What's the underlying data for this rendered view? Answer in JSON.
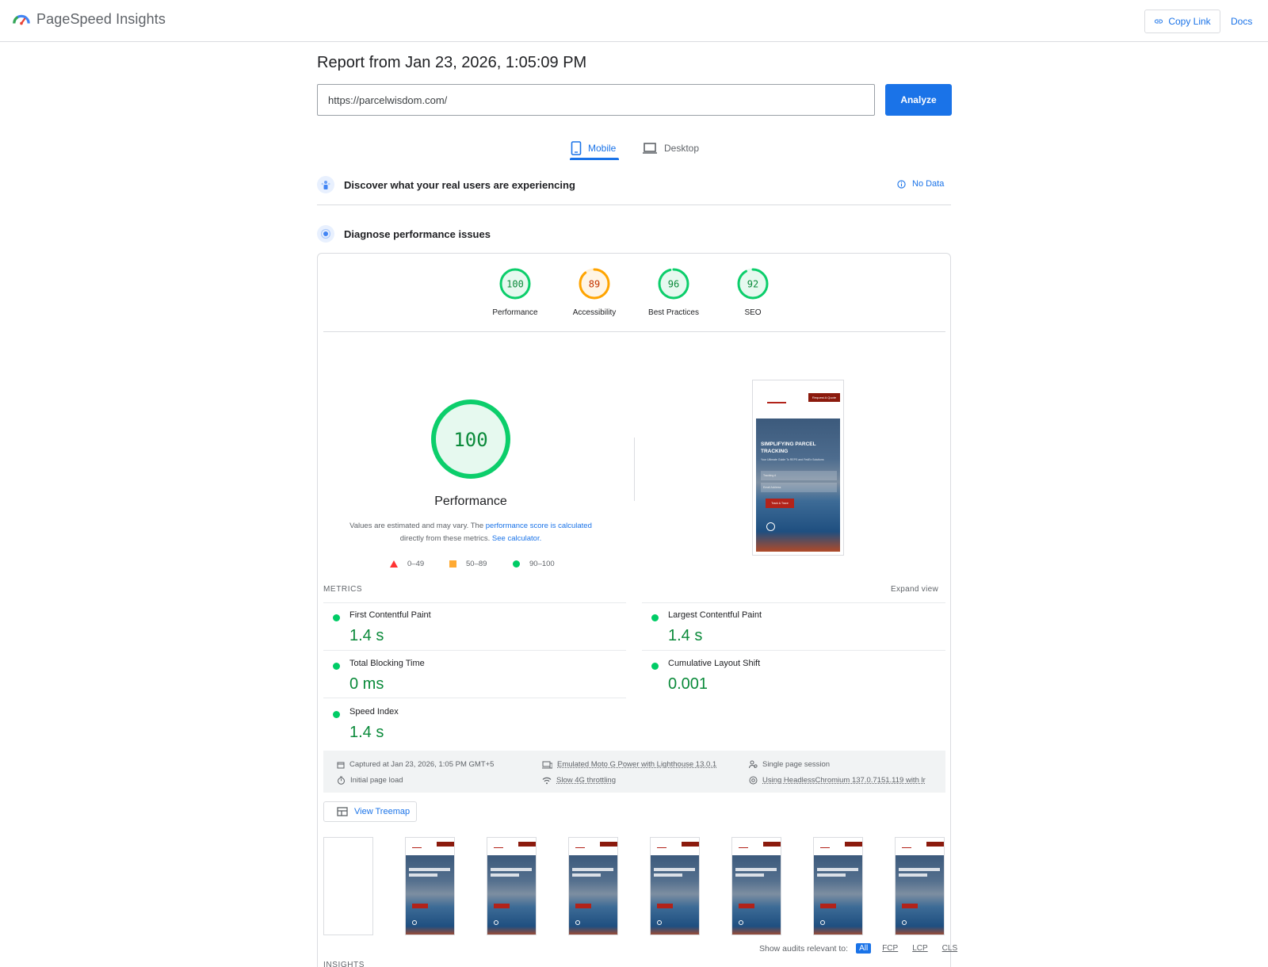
{
  "header": {
    "brand": "PageSpeed Insights",
    "copy_link": "Copy Link",
    "docs": "Docs"
  },
  "report": {
    "title": "Report from Jan 23, 2026, 1:05:09 PM",
    "url": "https://parcelwisdom.com/",
    "analyze_label": "Analyze"
  },
  "tabs": [
    {
      "label": "Mobile",
      "active": true
    },
    {
      "label": "Desktop",
      "active": false
    }
  ],
  "sections": {
    "discover": "Discover what your real users are experiencing",
    "no_data": "No Data",
    "diagnose": "Diagnose performance issues"
  },
  "scores": [
    {
      "label": "Performance",
      "value": 100,
      "color": "#0cce6b"
    },
    {
      "label": "Accessibility",
      "value": 89,
      "color": "#ffa400"
    },
    {
      "label": "Best Practices",
      "value": 96,
      "color": "#0cce6b"
    },
    {
      "label": "SEO",
      "value": 92,
      "color": "#0cce6b"
    }
  ],
  "performance": {
    "score": "100",
    "label": "Performance",
    "note_prefix": "Values are estimated and may vary. The ",
    "note_link1": "performance score is calculated",
    "note_mid": "directly from these metrics. ",
    "note_link2": "See calculator."
  },
  "legend": {
    "fail": "0–49",
    "average": "50–89",
    "pass": "90–100"
  },
  "screenshot": {
    "quote_btn": "Request A Quote",
    "hero_title": "SIMPLIFYING PARCEL TRACKING",
    "hero_sub": "Your Ultimate Guide To REPS and FedEx Solutions",
    "field1": "Tracking #",
    "field2": "Email Address",
    "cta": "Track & Trace"
  },
  "metrics": {
    "heading": "METRICS",
    "expand": "Expand view",
    "items": [
      {
        "title": "First Contentful Paint",
        "value": "1.4 s"
      },
      {
        "title": "Largest Contentful Paint",
        "value": "1.4 s"
      },
      {
        "title": "Total Blocking Time",
        "value": "0 ms"
      },
      {
        "title": "Cumulative Layout Shift",
        "value": "0.001"
      },
      {
        "title": "Speed Index",
        "value": "1.4 s"
      }
    ]
  },
  "info": {
    "captured": "Captured at Jan 23, 2026, 1:05 PM GMT+5",
    "initial": "Initial page load",
    "device": "Emulated Moto G Power with Lighthouse 13.0.1",
    "throttle": "Slow 4G throttling",
    "session": "Single page session",
    "browser": "Using HeadlessChromium 137.0.7151.119 with lr"
  },
  "treemap": "View Treemap",
  "audits": {
    "label": "Show audits relevant to:",
    "chips": [
      "All",
      "FCP",
      "LCP",
      "CLS"
    ]
  },
  "insights_heading": "INSIGHTS"
}
